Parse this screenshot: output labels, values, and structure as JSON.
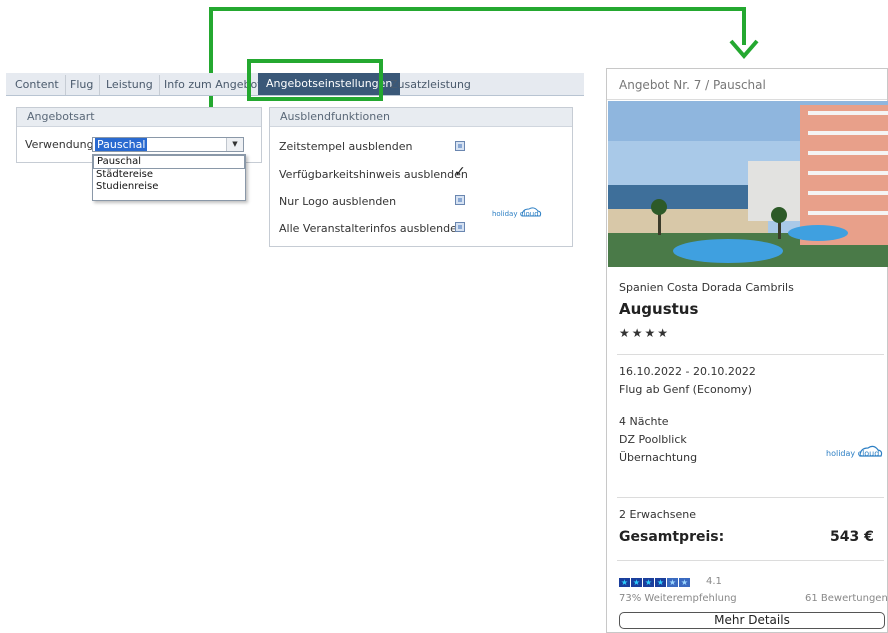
{
  "tabs": [
    {
      "label": "Content"
    },
    {
      "label": "Flug"
    },
    {
      "label": "Leistung"
    },
    {
      "label": "Info zum Angebot"
    },
    {
      "label": "Angebotseinstellungen"
    },
    {
      "label": "Zusatzleistung"
    }
  ],
  "active_tab": "Angebotseinstellungen",
  "angebotsart": {
    "heading": "Angebotsart",
    "label": "Verwendung",
    "selected": "Pauschal",
    "options": [
      "Pauschal",
      "Städtereise",
      "Studienreise"
    ]
  },
  "ausblend": {
    "heading": "Ausblendfunktionen",
    "items": [
      {
        "label": "Zeitstempel ausblenden",
        "checked": false
      },
      {
        "label": "Verfügbarkeitshinweis ausblenden",
        "checked": true
      },
      {
        "label": "Nur Logo ausblenden",
        "checked": false
      },
      {
        "label": "Alle Veranstalterinfos ausblenden",
        "checked": false
      }
    ],
    "logo_text": "holiday cloud"
  },
  "card": {
    "title": "Angebot Nr. 7 / Pauschal",
    "location": "Spanien Costa Dorada Cambrils",
    "hotel": "Augustus",
    "stars": "★★★★",
    "dates": "16.10.2022 - 20.10.2022",
    "flight": "Flug ab Genf (Economy)",
    "nights": "4 Nächte",
    "room": "DZ Poolblick",
    "board": "Übernachtung",
    "logo_text": "holiday cloud",
    "travellers": "2 Erwachsene",
    "price_label": "Gesamtpreis:",
    "price": "543 €",
    "rating": "4.1",
    "rating_stars": 4.1,
    "recommendation": "73% Weiterempfehlung",
    "reviews": "61 Bewertungen",
    "details_button": "Mehr Details"
  },
  "colors": {
    "highlight": "#24a830",
    "tab_active": "#3a5878",
    "selection": "#2a6ad0"
  }
}
